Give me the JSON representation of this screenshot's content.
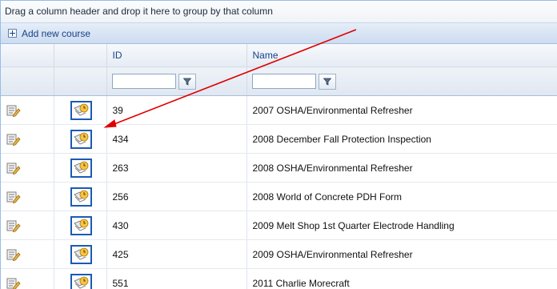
{
  "group_panel": {
    "text": "Drag a column header and drop it here to group by that column"
  },
  "command_bar": {
    "add_label": "Add new course"
  },
  "columns": {
    "id": "ID",
    "name": "Name"
  },
  "filters": {
    "id_value": "",
    "name_value": ""
  },
  "rows": [
    {
      "id": "39",
      "name": "2007 OSHA/Environmental Refresher"
    },
    {
      "id": "434",
      "name": "2008 December Fall Protection Inspection"
    },
    {
      "id": "263",
      "name": "2008 OSHA/Environmental Refresher"
    },
    {
      "id": "256",
      "name": "2008 World of Concrete PDH Form"
    },
    {
      "id": "430",
      "name": "2009 Melt Shop 1st Quarter Electrode Handling"
    },
    {
      "id": "425",
      "name": "2009 OSHA/Environmental Refresher"
    },
    {
      "id": "551",
      "name": "2011 Charlie Morecraft"
    }
  ],
  "colors": {
    "annotation_arrow": "#e00000",
    "header_text": "#15428b",
    "grid_border": "#99bbe8"
  }
}
